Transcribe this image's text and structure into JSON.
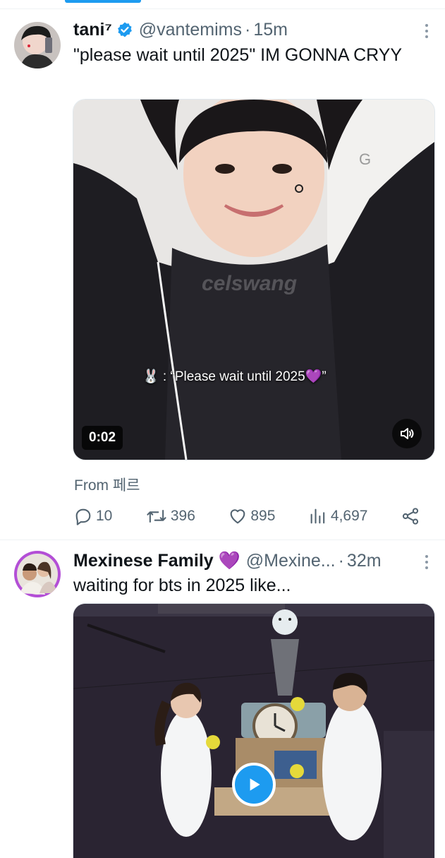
{
  "tweets": [
    {
      "display_name": "tani⁷",
      "handle": "@vantemims",
      "separator": "·",
      "time": "15m",
      "text": "\"please wait until 2025\" IM GONNA CRYY",
      "media": {
        "duration": "0:02",
        "caption": "🐰 : “Please wait until 2025💜”",
        "watermark": "celswang"
      },
      "from": "From 페르",
      "actions": {
        "replies": "10",
        "retweets": "396",
        "likes": "895",
        "views": "4,697"
      }
    },
    {
      "display_name": "Mexinese Family 💜",
      "handle": "@Mexine...",
      "separator": "·",
      "time": "32m",
      "text": "waiting for bts in 2025 like..."
    }
  ],
  "colors": {
    "accent": "#1d9bf0",
    "secondary_text": "#536471",
    "divider": "#eff3f4"
  },
  "icons": [
    "verified-badge-icon",
    "more-icon",
    "reply-icon",
    "retweet-icon",
    "like-icon",
    "views-icon",
    "share-icon",
    "volume-icon",
    "play-icon"
  ]
}
